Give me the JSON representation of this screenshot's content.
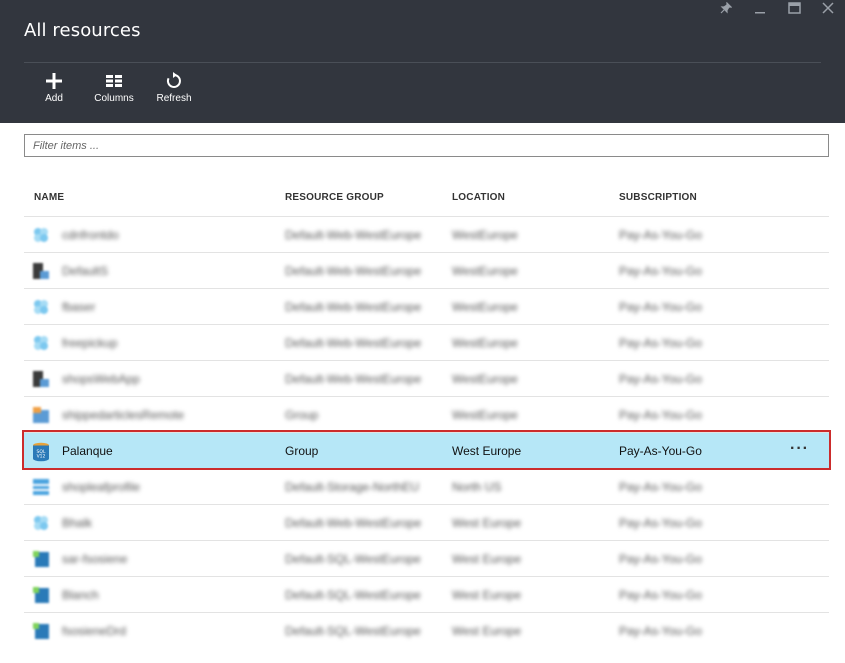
{
  "blade": {
    "title": "All resources",
    "window_controls": [
      "pin-icon",
      "minimize-icon",
      "maximize-icon",
      "close-icon"
    ]
  },
  "toolbar": {
    "add_label": "Add",
    "columns_label": "Columns",
    "refresh_label": "Refresh"
  },
  "filter": {
    "placeholder": "Filter items ..."
  },
  "table": {
    "columns": {
      "name": "NAME",
      "resource_group": "RESOURCE GROUP",
      "location": "LOCATION",
      "subscription": "SUBSCRIPTION"
    },
    "rows": [
      {
        "name": "cdnfrontdo",
        "rg": "Default-Web-WestEurope",
        "loc": "WestEurope",
        "sub": "Pay-As-You-Go",
        "icon": "cloud-service-icon",
        "blurred": true
      },
      {
        "name": "DefaultS",
        "rg": "Default-Web-WestEurope",
        "loc": "WestEurope",
        "sub": "Pay-As-You-Go",
        "icon": "app-service-plan-icon",
        "blurred": true
      },
      {
        "name": "fbaser",
        "rg": "Default-Web-WestEurope",
        "loc": "WestEurope",
        "sub": "Pay-As-You-Go",
        "icon": "cloud-service-icon",
        "blurred": true
      },
      {
        "name": "freepickup",
        "rg": "Default-Web-WestEurope",
        "loc": "WestEurope",
        "sub": "Pay-As-You-Go",
        "icon": "cloud-service-icon",
        "blurred": true
      },
      {
        "name": "shopsWebApp",
        "rg": "Default-Web-WestEurope",
        "loc": "WestEurope",
        "sub": "Pay-As-You-Go",
        "icon": "app-service-plan-icon",
        "blurred": true
      },
      {
        "name": "shippedarticlesRemote",
        "rg": "Group",
        "loc": "WestEurope",
        "sub": "Pay-As-You-Go",
        "icon": "web-app-icon",
        "blurred": true
      },
      {
        "name": "Palanque",
        "rg": "Group",
        "loc": "West Europe",
        "sub": "Pay-As-You-Go",
        "icon": "sql-database-icon",
        "blurred": false,
        "selected": true
      },
      {
        "name": "shopleafprofile",
        "rg": "Default-Storage-NorthEU",
        "loc": "North US",
        "sub": "Pay-As-You-Go",
        "icon": "storage-account-icon",
        "blurred": true
      },
      {
        "name": "Bhalk",
        "rg": "Default-Web-WestEurope",
        "loc": "West Europe",
        "sub": "Pay-As-You-Go",
        "icon": "cloud-service-icon",
        "blurred": true
      },
      {
        "name": "sar-fsosiene",
        "rg": "Default-SQL-WestEurope",
        "loc": "West Europe",
        "sub": "Pay-As-You-Go",
        "icon": "sql-server-icon",
        "blurred": true
      },
      {
        "name": "Blanch",
        "rg": "Default-SQL-WestEurope",
        "loc": "West Europe",
        "sub": "Pay-As-You-Go",
        "icon": "sql-server-icon",
        "blurred": true
      },
      {
        "name": "fsosieneDrd",
        "rg": "Default-SQL-WestEurope",
        "loc": "West Europe",
        "sub": "Pay-As-You-Go",
        "icon": "sql-server-icon",
        "blurred": true
      }
    ],
    "row_more_label": "···"
  },
  "colors": {
    "header_bg": "#32363e",
    "selected_row_bg": "#b6e7f7",
    "selection_border": "#cc2c2c"
  }
}
